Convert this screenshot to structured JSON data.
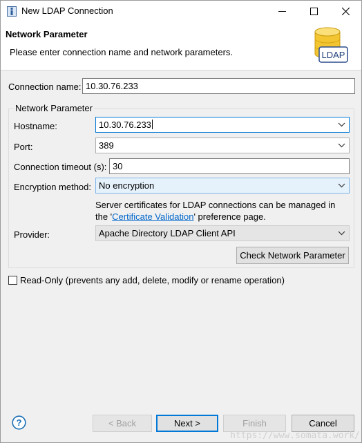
{
  "window": {
    "title": "New LDAP Connection"
  },
  "header": {
    "title": "Network Parameter",
    "description": "Please enter connection name and network parameters.",
    "logo_text": "LDAP"
  },
  "form": {
    "connection_name_label": "Connection name:",
    "connection_name_value": "10.30.76.233",
    "group_title": "Network Parameter",
    "hostname_label": "Hostname:",
    "hostname_value": "10.30.76.233",
    "port_label": "Port:",
    "port_value": "389",
    "timeout_label": "Connection timeout (s):",
    "timeout_value": "30",
    "encryption_label": "Encryption method:",
    "encryption_value": "No encryption",
    "cert_note_line1": "Server certificates for LDAP connections can be managed in",
    "cert_note_prefix": "the '",
    "cert_note_link": "Certificate Validation",
    "cert_note_suffix": "' preference page.",
    "provider_label": "Provider:",
    "provider_value": "Apache Directory LDAP Client API",
    "check_button": "Check Network Parameter",
    "readonly_label": "Read-Only (prevents any add, delete, modify or rename operation)"
  },
  "footer": {
    "back": "< Back",
    "next": "Next >",
    "finish": "Finish",
    "cancel": "Cancel"
  },
  "watermark": "https://www.somata.work/",
  "colors": {
    "focus": "#0078d7",
    "link": "#0066cc",
    "help": "#1a6fb5"
  }
}
